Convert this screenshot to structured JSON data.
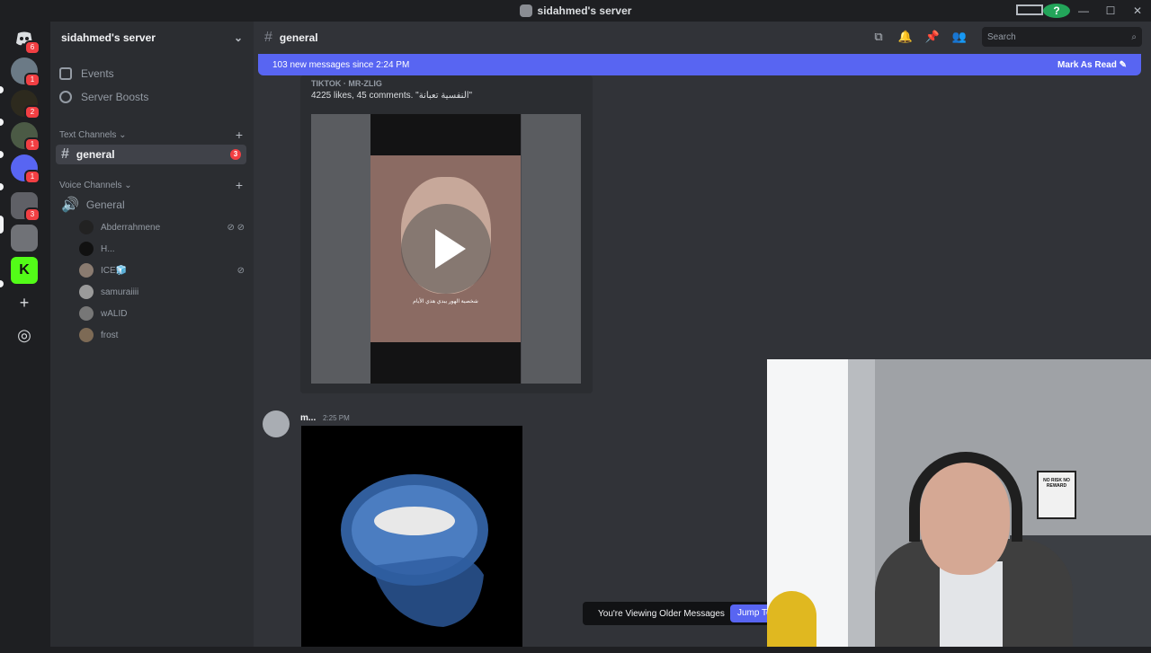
{
  "window": {
    "title": "sidahmed's server"
  },
  "guilds": {
    "items": [
      {
        "name": "direct-messages",
        "badge": "6"
      },
      {
        "name": "server-2",
        "badge": "1"
      },
      {
        "name": "server-3",
        "badge": "2"
      },
      {
        "name": "server-4",
        "badge": "1"
      },
      {
        "name": "server-5",
        "badge": "1"
      },
      {
        "name": "server-6",
        "badge": "3"
      },
      {
        "name": "server-7",
        "badge": ""
      },
      {
        "name": "server-kick",
        "badge": ""
      }
    ]
  },
  "sidebar": {
    "server_name": "sidahmed's server",
    "events_label": "Events",
    "boosts_label": "Server Boosts",
    "text_category": "Text Channels",
    "voice_category": "Voice Channels",
    "text_channels": [
      {
        "name": "general",
        "badge": "3"
      }
    ],
    "voice_channels": [
      {
        "name": "General"
      }
    ],
    "voice_users": [
      {
        "name": "Abderrahmene"
      },
      {
        "name": "H..."
      },
      {
        "name": "ICE🧊"
      },
      {
        "name": "samuraiiii"
      },
      {
        "name": "wALID"
      },
      {
        "name": "frost"
      }
    ]
  },
  "main": {
    "channel_name": "general",
    "search_placeholder": "Search",
    "new_messages_text": "103 new messages since 2:24 PM",
    "mark_read_label": "Mark As Read",
    "embed": {
      "provider": "TIKTOK · MR-ZLIG",
      "description": "4225 likes, 45 comments. \"النفسية تعبانة\"",
      "caption": "شخصية الهور يبدي هذي الأيام"
    },
    "message": {
      "author": "m...",
      "time": "2:25 PM"
    },
    "older_messages_text": "You're Viewing Older Messages",
    "jump_label": "Jump To Present"
  },
  "webcam": {
    "poster_text": "NO RISK NO REWARD"
  },
  "colors": {
    "accent": "#5865f2",
    "mention_red": "#f23f43",
    "sidebar_bg": "#2b2d31",
    "chat_bg": "#313338"
  }
}
